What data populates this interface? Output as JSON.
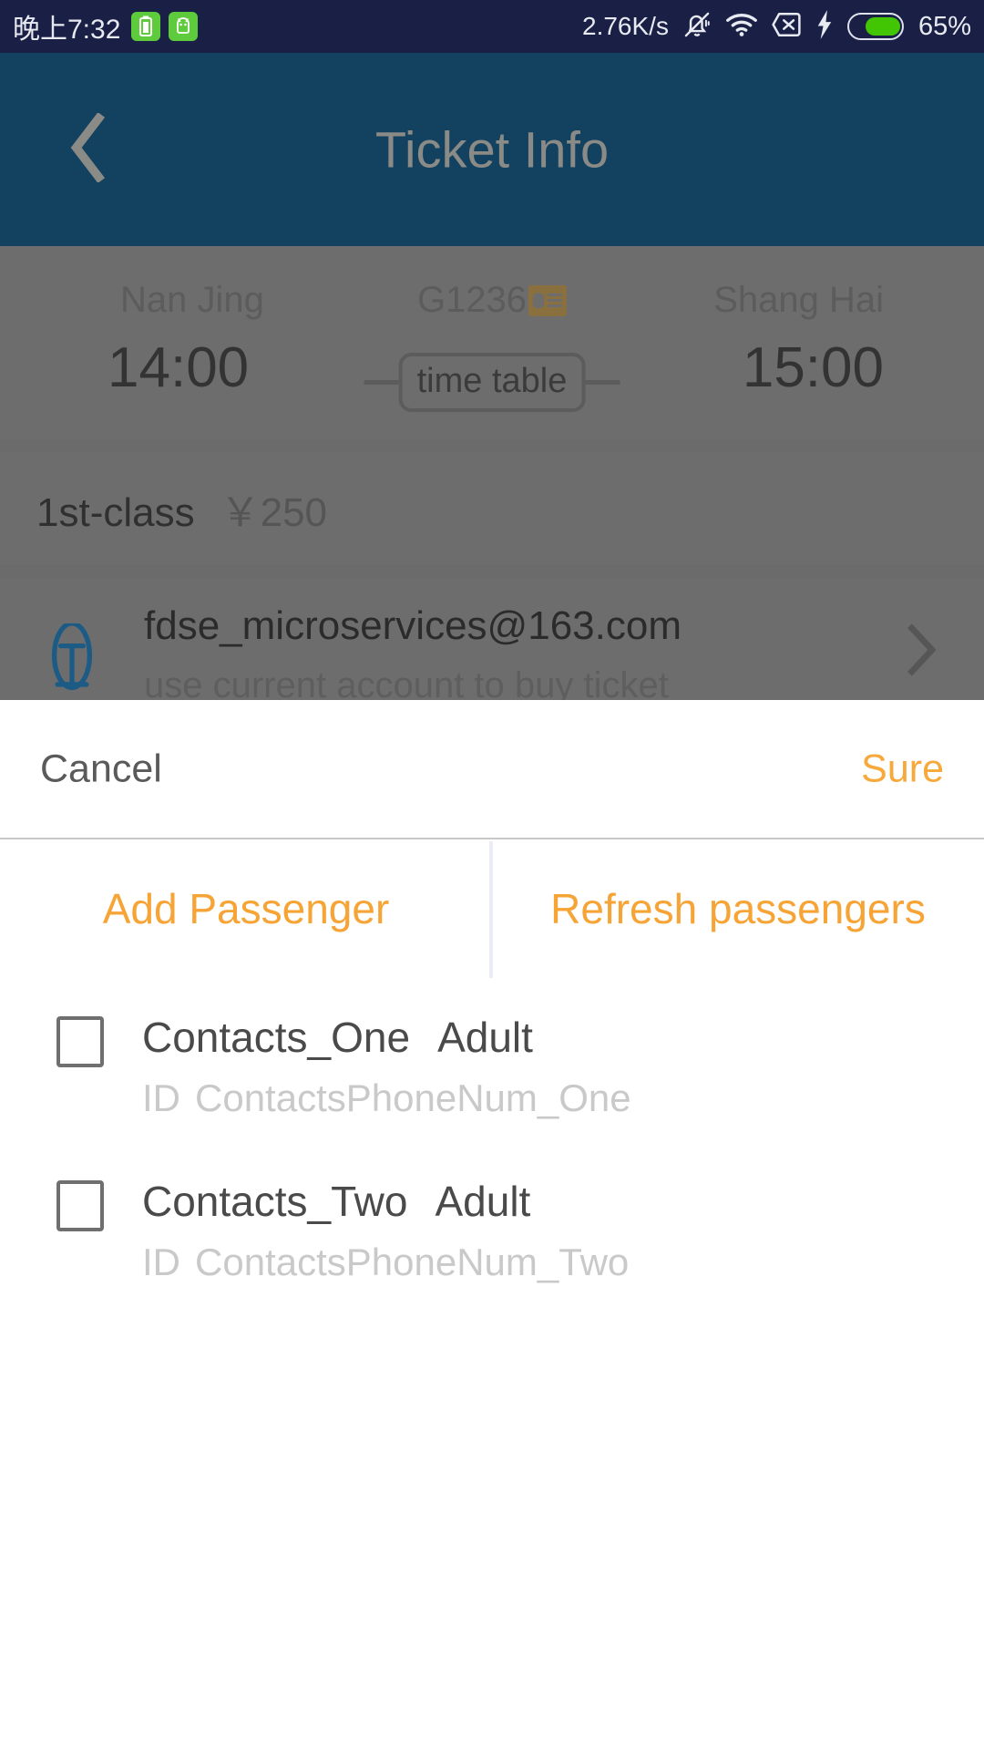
{
  "status_bar": {
    "time": "晚上7:32",
    "battery_chip_icon": "battery-chip-icon",
    "app_chip_icon": "android-robot-icon",
    "network_speed": "2.76K/s",
    "mute_icon": "bell-muted-icon",
    "wifi_icon": "wifi-icon",
    "sim_icon": "sim-card-x-icon",
    "charging_icon": "lightning-bolt-icon",
    "battery_icon": "battery-icon",
    "battery_percent": "65%"
  },
  "nav": {
    "back_icon": "back-chevron-icon",
    "title": "Ticket Info"
  },
  "trip": {
    "from_city": "Nan Jing",
    "from_time": "14:00",
    "to_city": "Shang Hai",
    "to_time": "15:00",
    "train_number": "G1236",
    "train_type_icon": "id-card-icon",
    "timetable_label": "time table"
  },
  "seat": {
    "class_name": "1st-class",
    "price": "￥250"
  },
  "account": {
    "icon": "person-outline-icon",
    "email": "fdse_microservices@163.com",
    "subtitle": "use current account to buy ticket",
    "chevron_icon": "chevron-right-icon"
  },
  "sheet": {
    "cancel_label": "Cancel",
    "sure_label": "Sure",
    "add_passenger_label": "Add Passenger",
    "refresh_passengers_label": "Refresh passengers",
    "contacts": [
      {
        "checkbox_icon": "checkbox-unchecked-icon",
        "name": "Contacts_One",
        "type": "Adult",
        "id_label": "ID",
        "id_value": "ContactsPhoneNum_One"
      },
      {
        "checkbox_icon": "checkbox-unchecked-icon",
        "name": "Contacts_Two",
        "type": "Adult",
        "id_label": "ID",
        "id_value": "ContactsPhoneNum_Two"
      }
    ]
  },
  "colors": {
    "status_bar_bg": "#1a1f45",
    "nav_bg": "#134260",
    "accent_orange": "#f7a436",
    "battery_green": "#42c502",
    "dim_overlay": "#6d6d6d",
    "id_card_gold": "#8a6f3f"
  }
}
